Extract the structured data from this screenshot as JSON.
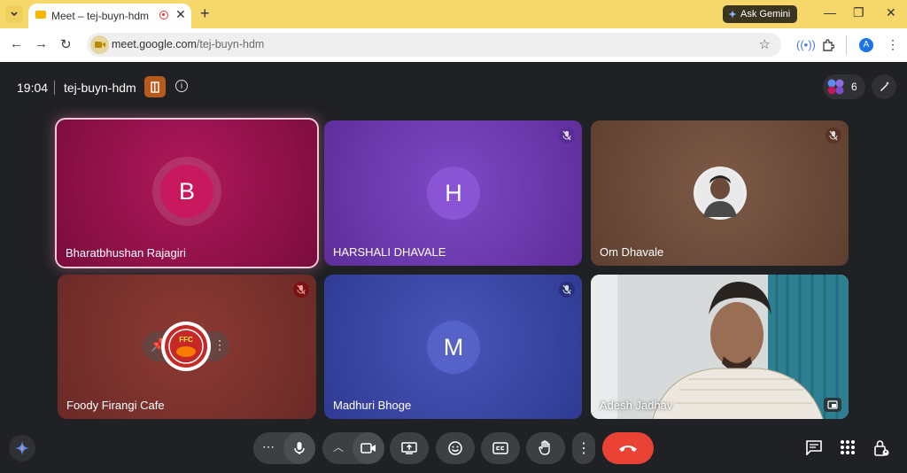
{
  "browser": {
    "tab_title": "Meet – tej-buyn-hdm",
    "gemini_label": "Ask Gemini",
    "url_host": "meet.google.com",
    "url_path": "/tej-buyn-hdm",
    "profile_initial": "A",
    "window_controls": [
      "minimize",
      "restore",
      "close"
    ]
  },
  "meeting": {
    "time": "19:04",
    "code": "tej-buyn-hdm",
    "participant_count": "6"
  },
  "tiles": [
    {
      "name": "Bharatbhushan Rajagiri",
      "initial": "B",
      "muted": false,
      "speaking": true
    },
    {
      "name": "HARSHALI DHAVALE",
      "initial": "H",
      "muted": true
    },
    {
      "name": "Om Dhavale",
      "initial": "",
      "muted": true,
      "avatar": "photo"
    },
    {
      "name": "Foody Firangi Cafe",
      "initial": "",
      "muted": true,
      "avatar": "logo"
    },
    {
      "name": "Madhuri Bhoge",
      "initial": "M",
      "muted": true
    },
    {
      "name": "Adesh Jadhav",
      "initial": "",
      "muted": false,
      "avatar": "camera"
    }
  ],
  "controls": {
    "left": [
      "gemini-icon"
    ],
    "center": [
      "more-options",
      "microphone",
      "camera-options",
      "camera",
      "present",
      "reactions",
      "captions",
      "raise-hand",
      "more",
      "end-call"
    ],
    "right": [
      "chat",
      "activities",
      "host-controls"
    ]
  },
  "colors": {
    "meet_bg": "#202124",
    "end_call": "#ea4335",
    "speaking_border": "#f5c9d8"
  }
}
